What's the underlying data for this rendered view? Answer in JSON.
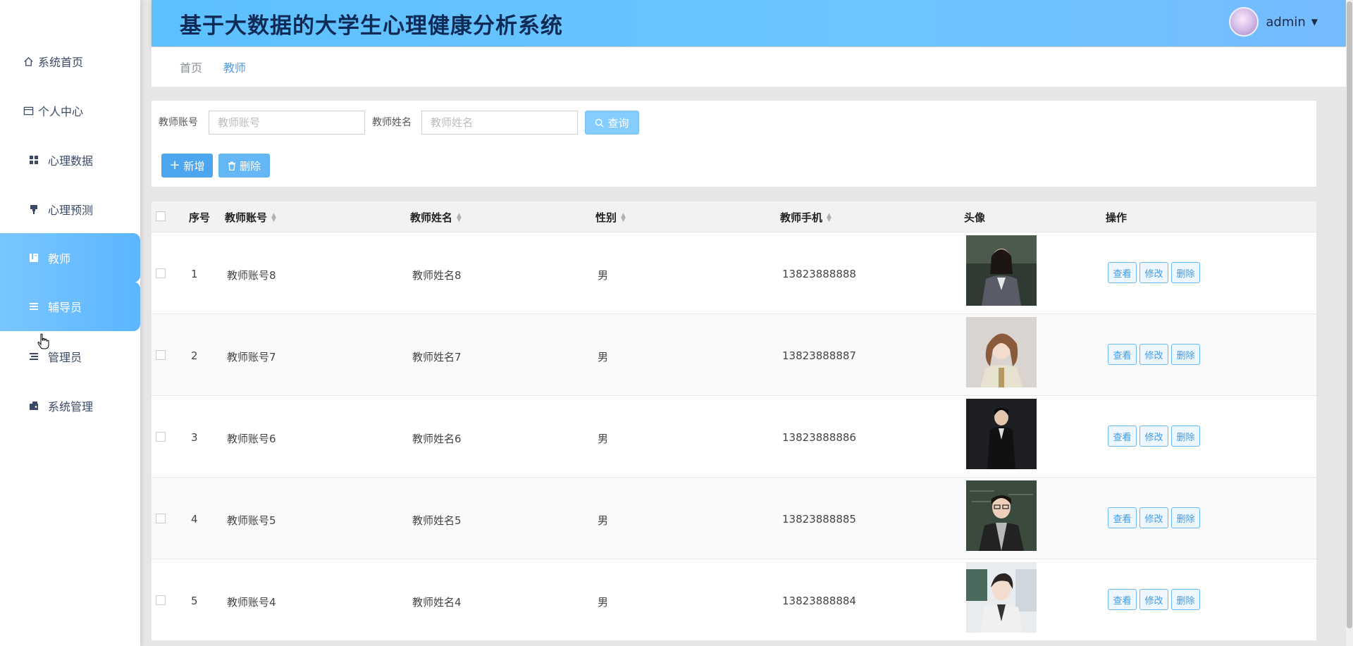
{
  "app": {
    "title": "基于大数据的大学生心理健康分析系统"
  },
  "user": {
    "name": "admin"
  },
  "sidebar": {
    "items": [
      {
        "label": "系统首页",
        "icon": "home-icon"
      },
      {
        "label": "个人中心",
        "icon": "card-icon"
      },
      {
        "label": "心理数据",
        "icon": "grid-icon"
      },
      {
        "label": "心理预测",
        "icon": "pin-icon"
      },
      {
        "label": "教师",
        "icon": "book-icon"
      },
      {
        "label": "辅导员",
        "icon": "list-icon"
      },
      {
        "label": "管理员",
        "icon": "list-icon"
      },
      {
        "label": "系统管理",
        "icon": "settings-icon"
      }
    ]
  },
  "breadcrumb": {
    "home": "首页",
    "current": "教师"
  },
  "search": {
    "account_label": "教师账号",
    "account_placeholder": "教师账号",
    "name_label": "教师姓名",
    "name_placeholder": "教师姓名",
    "query_label": "查询"
  },
  "toolbar": {
    "add_label": "新增",
    "delete_label": "删除"
  },
  "table": {
    "headers": {
      "index": "序号",
      "account": "教师账号",
      "name": "教师姓名",
      "gender": "性别",
      "phone": "教师手机",
      "avatar": "头像",
      "actions": "操作"
    },
    "actions": {
      "view": "查看",
      "edit": "修改",
      "delete": "删除"
    },
    "rows": [
      {
        "index": "1",
        "account": "教师账号8",
        "name": "教师姓名8",
        "gender": "男",
        "phone": "13823888888"
      },
      {
        "index": "2",
        "account": "教师账号7",
        "name": "教师姓名7",
        "gender": "男",
        "phone": "13823888887"
      },
      {
        "index": "3",
        "account": "教师账号6",
        "name": "教师姓名6",
        "gender": "男",
        "phone": "13823888886"
      },
      {
        "index": "4",
        "account": "教师账号5",
        "name": "教师姓名5",
        "gender": "男",
        "phone": "13823888885"
      },
      {
        "index": "5",
        "account": "教师账号4",
        "name": "教师姓名4",
        "gender": "男",
        "phone": "13823888884"
      }
    ]
  },
  "colors": {
    "accent": "#5cb6ff",
    "header_start": "#5cc0ff",
    "title": "#0f2a55"
  }
}
